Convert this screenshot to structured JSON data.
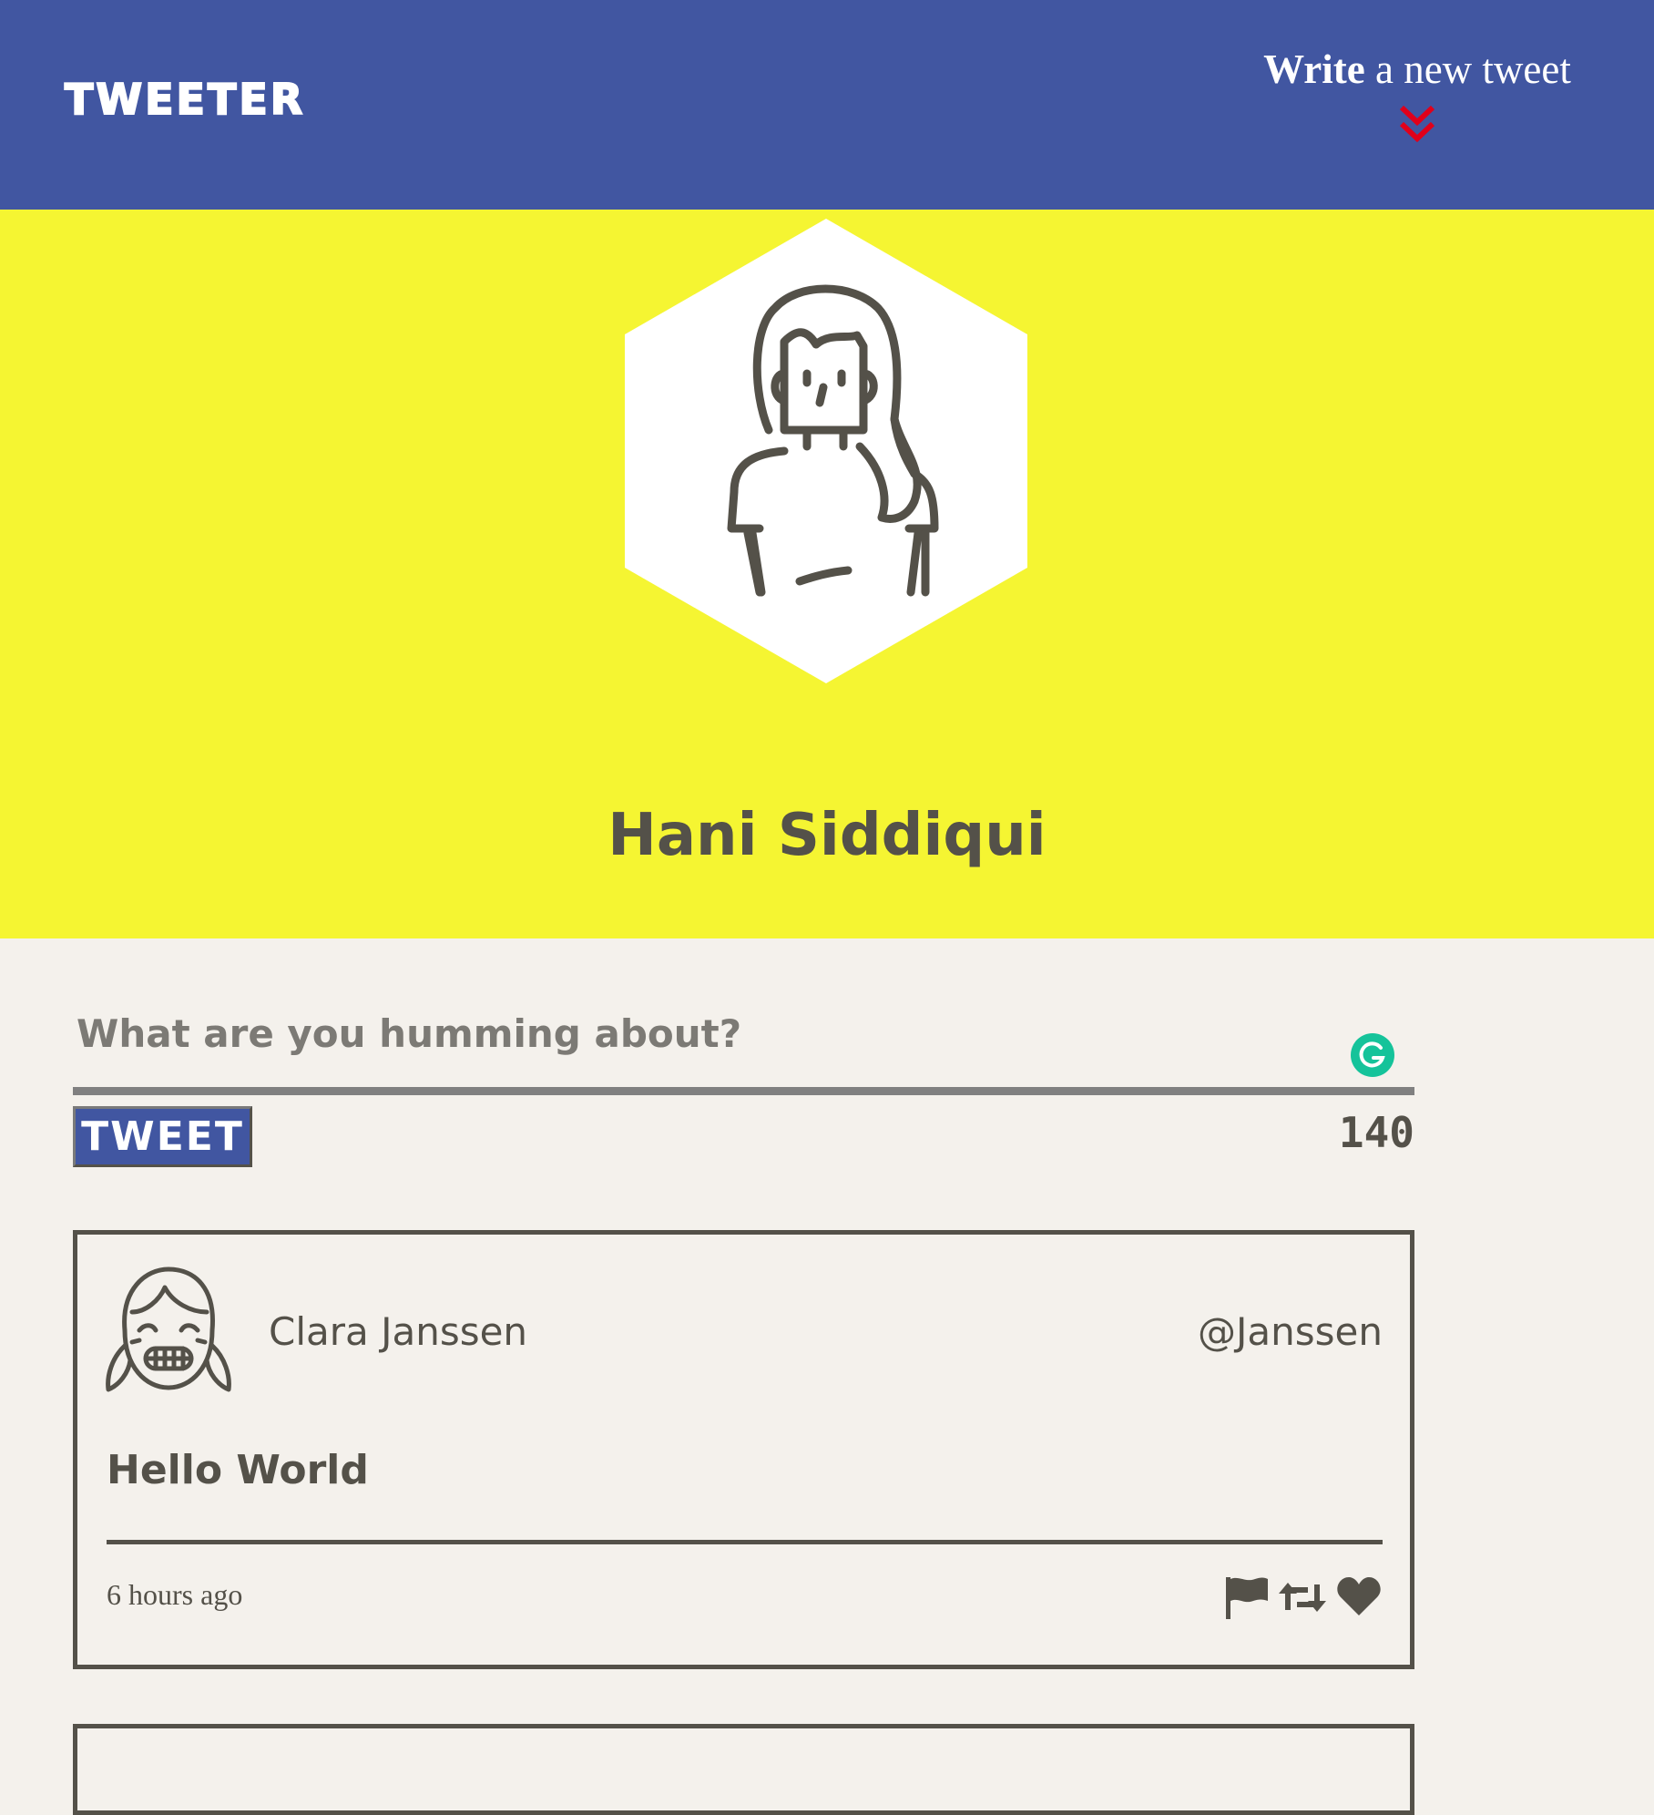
{
  "header": {
    "brand": "TWEETER",
    "compose_toggle": {
      "bold_word": "Write",
      "rest": " a new tweet",
      "icon": "double-chevron-down-icon",
      "icon_color": "#e0001b"
    },
    "background": "#4156a1"
  },
  "profile": {
    "name": "Hani Siddiqui",
    "avatar_icon": "woman-avatar-icon",
    "banner_color": "#f5f532"
  },
  "composer": {
    "placeholder": "What are you humming about?",
    "value": "",
    "button_label": "TWEET",
    "char_count": "140",
    "assistant_icon": "grammarly-icon"
  },
  "tweets": [
    {
      "author": "Clara Janssen",
      "handle": "@Janssen",
      "avatar_icon": "girl-avatar-icon",
      "body": "Hello World",
      "time": "6 hours ago",
      "actions": [
        "flag-icon",
        "retweet-icon",
        "heart-icon"
      ]
    }
  ]
}
